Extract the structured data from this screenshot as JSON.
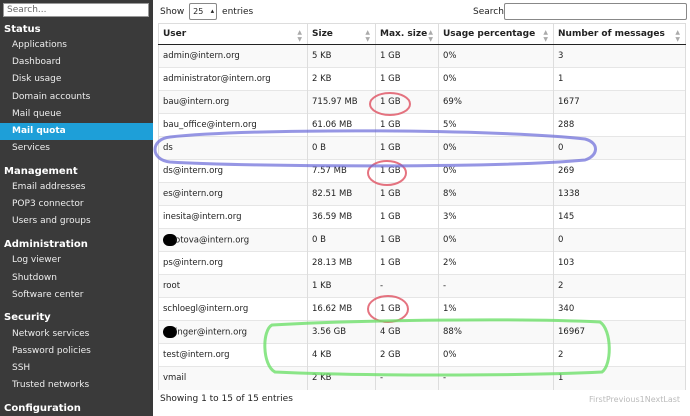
{
  "sidebar": {
    "search_placeholder": "Search...",
    "sections": [
      {
        "title": "Status",
        "items": [
          "Applications",
          "Dashboard",
          "Disk usage",
          "Domain accounts",
          "Mail queue",
          "Mail quota",
          "Services"
        ]
      },
      {
        "title": "Management",
        "items": [
          "Email addresses",
          "POP3 connector",
          "Users and groups"
        ]
      },
      {
        "title": "Administration",
        "items": [
          "Log viewer",
          "Shutdown",
          "Software center"
        ]
      },
      {
        "title": "Security",
        "items": [
          "Network services",
          "Password policies",
          "SSH",
          "Trusted networks"
        ]
      },
      {
        "title": "Configuration",
        "items": []
      }
    ],
    "active_item": "Mail quota"
  },
  "controls": {
    "show_label": "Show",
    "entries_value": "25",
    "entries_label": "entries",
    "search_label": "Search:"
  },
  "table": {
    "columns": [
      "User",
      "Size",
      "Max. size",
      "Usage percentage",
      "Number of messages"
    ],
    "rows": [
      [
        "admin@intern.org",
        "5 KB",
        "1 GB",
        "0%",
        "3"
      ],
      [
        "administrator@intern.org",
        "2 KB",
        "1 GB",
        "0%",
        "1"
      ],
      [
        "bau@intern.org",
        "715.97 MB",
        "1 GB",
        "69%",
        "1677"
      ],
      [
        "bau_office@intern.org",
        "61.06 MB",
        "1 GB",
        "5%",
        "288"
      ],
      [
        "ds",
        "0 B",
        "1 GB",
        "0%",
        "0"
      ],
      [
        "ds@intern.org",
        "7.57 MB",
        "1 GB",
        "0%",
        "269"
      ],
      [
        "es@intern.org",
        "82.51 MB",
        "1 GB",
        "8%",
        "1338"
      ],
      [
        "inesita@intern.org",
        "36.59 MB",
        "1 GB",
        "3%",
        "145"
      ],
      [
        "otova@intern.org",
        "0 B",
        "1 GB",
        "0%",
        "0"
      ],
      [
        "ps@intern.org",
        "28.13 MB",
        "1 GB",
        "2%",
        "103"
      ],
      [
        "root",
        "1 KB",
        "-",
        "-",
        "2"
      ],
      [
        "schloegl@intern.org",
        "16.62 MB",
        "1 GB",
        "1%",
        "340"
      ],
      [
        "inger@intern.org",
        "3.56 GB",
        "4 GB",
        "88%",
        "16967"
      ],
      [
        "test@intern.org",
        "4 KB",
        "2 GB",
        "0%",
        "2"
      ],
      [
        "vmail",
        "2 KB",
        "-",
        "-",
        "1"
      ]
    ]
  },
  "footer": {
    "info": "Showing 1 to 15 of 15 entries",
    "pager": [
      "First",
      "Previous",
      "1",
      "Next",
      "Last"
    ]
  },
  "annotations": {
    "red": "#e05a6a",
    "blue": "#6a6ad8",
    "green": "#6ee06a"
  }
}
